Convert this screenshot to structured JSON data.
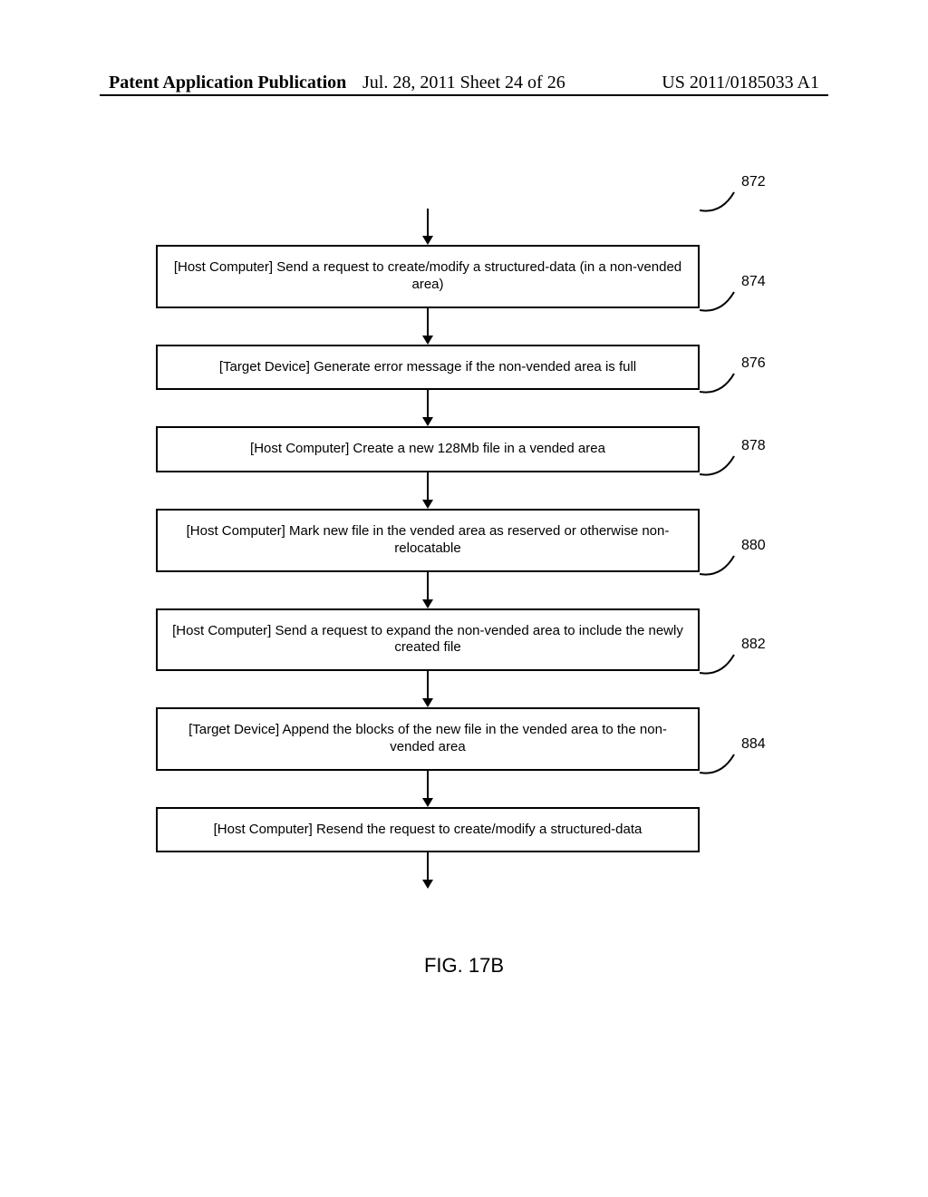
{
  "header": {
    "left": "Patent Application Publication",
    "center": "Jul. 28, 2011  Sheet 24 of 26",
    "right": "US 2011/0185033 A1"
  },
  "steps": [
    {
      "ref": "872",
      "text": "[Host Computer] Send a request to create/modify a structured-data (in a non-vended area)"
    },
    {
      "ref": "874",
      "text": "[Target Device] Generate error message if the non-vended area is full"
    },
    {
      "ref": "876",
      "text": "[Host Computer] Create a new 128Mb file in a vended area"
    },
    {
      "ref": "878",
      "text": "[Host Computer] Mark new file in the vended area as reserved or otherwise non-relocatable"
    },
    {
      "ref": "880",
      "text": "[Host Computer] Send a request to expand the non-vended area to include the newly created file"
    },
    {
      "ref": "882",
      "text": "[Target Device] Append the blocks of the new file in the vended area to the non-vended area"
    },
    {
      "ref": "884",
      "text": "[Host Computer] Resend the request to create/modify a structured-data"
    }
  ],
  "figure_caption": "FIG. 17B"
}
